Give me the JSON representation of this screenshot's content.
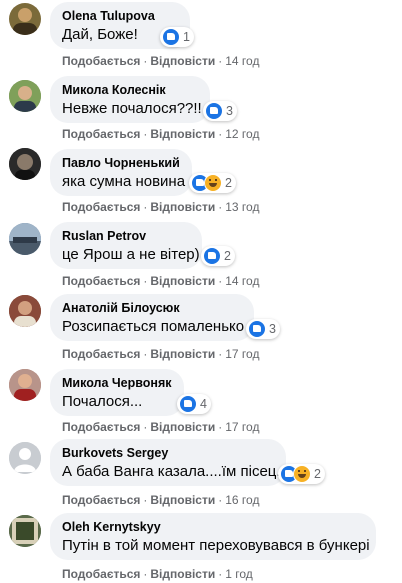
{
  "actions": {
    "like": "Подобається",
    "reply": "Відповісти",
    "sep": "·"
  },
  "comments": [
    {
      "author": "Olena Tulupova",
      "text": "Дай, Боже!",
      "count": "1",
      "time": "14 год",
      "avatar_color": "#7b6a3a"
    },
    {
      "author": "Микола Колеснік",
      "text": "Невже почалося??!!",
      "count": "3",
      "time": "12 год",
      "avatar_color": "#6f8b57"
    },
    {
      "author": "Павло Чорненький",
      "text": "яка сумна новина",
      "count": "2",
      "time": "13 год",
      "avatar_color": "#3a3a3a"
    },
    {
      "author": "Ruslan Petrov",
      "text": "це Ярош а не вітер)",
      "count": "2",
      "time": "14 год",
      "avatar_color": "#5a7898"
    },
    {
      "author": "Анатолій Білоусюк",
      "text": "Розсипається помаленько",
      "count": "3",
      "time": "17 год",
      "avatar_color": "#6b3b2a"
    },
    {
      "author": "Микола Червоняк",
      "text": "Почалося...",
      "count": "4",
      "time": "17 год",
      "avatar_color": "#a8746a"
    },
    {
      "author": "Burkovets Sergey",
      "text": "А баба Ванга казала....їм пісец.",
      "count": "2",
      "time": "16 год",
      "avatar_color": "#c8ccd1"
    },
    {
      "author": "Oleh Kernytskyy",
      "text": "Путін в той момент переховувався в бункері",
      "count": "",
      "time": "1 год",
      "avatar_color": "#4a5a3a"
    }
  ],
  "colors": {
    "like": "#1b74e4",
    "haha": "#f7b125",
    "bubble": "#f0f2f5",
    "meta": "#65676b"
  }
}
